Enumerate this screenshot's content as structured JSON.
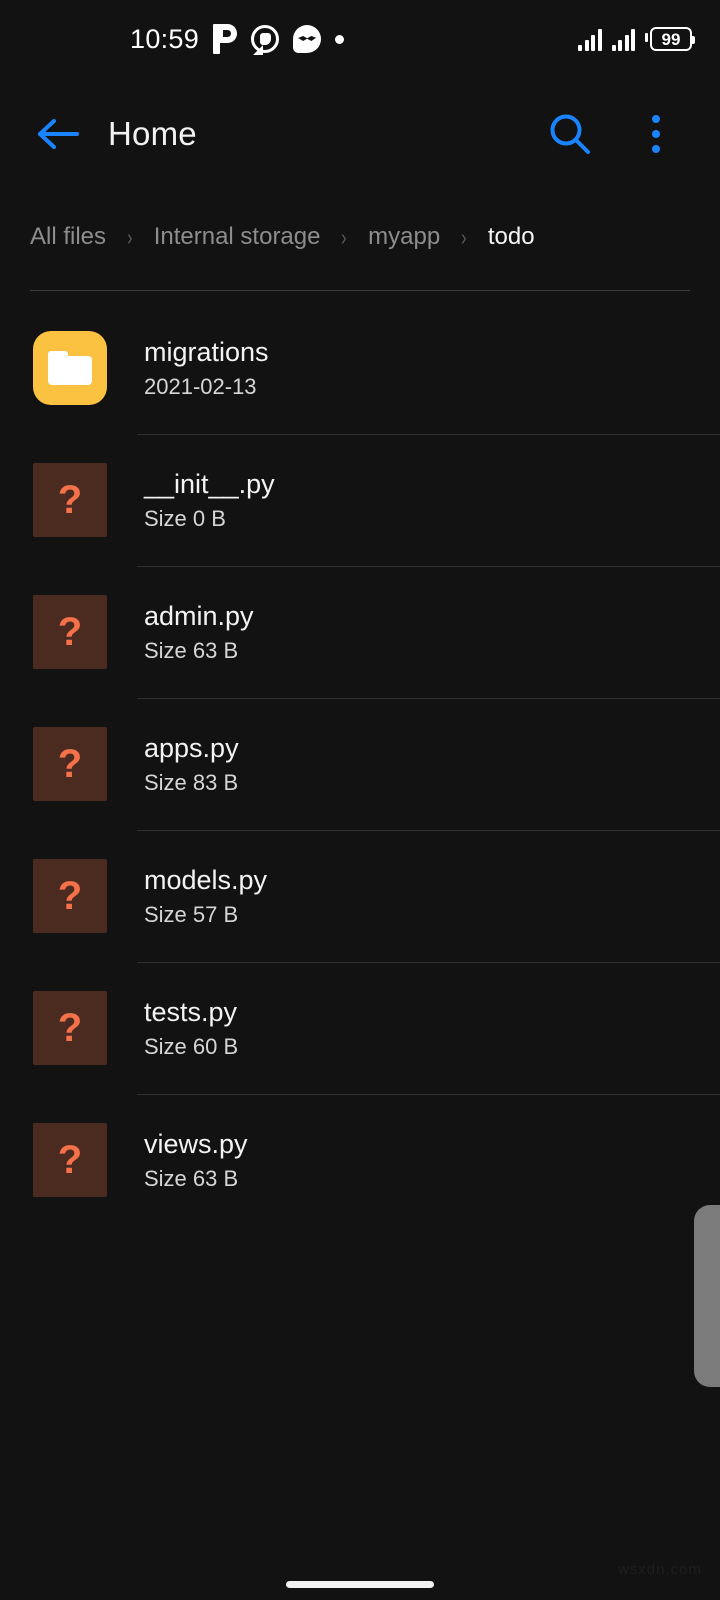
{
  "statusbar": {
    "time": "10:59",
    "notification_icons": [
      "paytm-icon",
      "whatsapp-icon",
      "messenger-icon",
      "dot-icon"
    ],
    "signal_icons": [
      "signal-bars-sim1-icon",
      "signal-bars-sim2-icon"
    ],
    "battery_level": "99"
  },
  "appbar": {
    "back_icon": "arrow-left-icon",
    "title": "Home",
    "search_icon": "search-icon",
    "overflow_icon": "more-vertical-icon",
    "accent_color": "#1a84ff"
  },
  "breadcrumb": {
    "separator": "›",
    "items": [
      {
        "label": "All files",
        "active": false
      },
      {
        "label": "Internal storage",
        "active": false
      },
      {
        "label": "myapp",
        "active": false
      },
      {
        "label": "todo",
        "active": true
      }
    ]
  },
  "file_list": {
    "items": [
      {
        "name": "migrations",
        "sub": "2021-02-13",
        "kind": "folder",
        "icon": "folder-icon"
      },
      {
        "name": "__init__.py",
        "sub": "Size 0 B",
        "kind": "file",
        "icon": "unknown-file-icon"
      },
      {
        "name": "admin.py",
        "sub": "Size 63 B",
        "kind": "file",
        "icon": "unknown-file-icon"
      },
      {
        "name": "apps.py",
        "sub": "Size 83 B",
        "kind": "file",
        "icon": "unknown-file-icon"
      },
      {
        "name": "models.py",
        "sub": "Size 57 B",
        "kind": "file",
        "icon": "unknown-file-icon"
      },
      {
        "name": "tests.py",
        "sub": "Size 60 B",
        "kind": "file",
        "icon": "unknown-file-icon"
      },
      {
        "name": "views.py",
        "sub": "Size 63 B",
        "kind": "file",
        "icon": "unknown-file-icon"
      }
    ]
  },
  "colors": {
    "background": "#121212",
    "folder_amber": "#fbc141",
    "unknown_brown": "#4b2b1f",
    "unknown_orange": "#f4714a",
    "accent_blue": "#1a84ff"
  },
  "watermark": {
    "text": "wsxdn.com"
  }
}
